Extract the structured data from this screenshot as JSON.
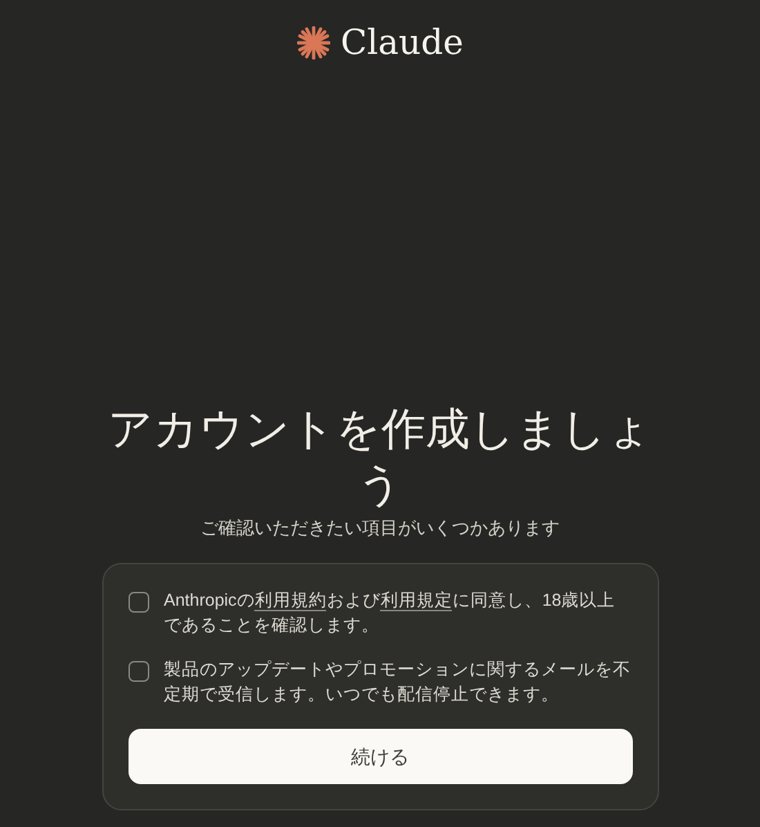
{
  "logo": {
    "wordmark": "Claude"
  },
  "heading": "アカウントを作成しましょう",
  "subtitle": "ご確認いただきたい項目がいくつかあります",
  "consents": [
    {
      "checked": false,
      "parts": [
        {
          "kind": "text",
          "text": "Anthropicの"
        },
        {
          "kind": "link",
          "text": "利用規約"
        },
        {
          "kind": "text",
          "text": "および"
        },
        {
          "kind": "link",
          "text": "利用規定"
        },
        {
          "kind": "text",
          "text": "に同意し、18歳以上であることを確認します。"
        }
      ]
    },
    {
      "checked": false,
      "parts": [
        {
          "kind": "text",
          "text": "製品のアップデートやプロモーションに関するメールを不定期で受信します。いつでも配信停止できます。"
        }
      ]
    }
  ],
  "continue_button": "続ける"
}
